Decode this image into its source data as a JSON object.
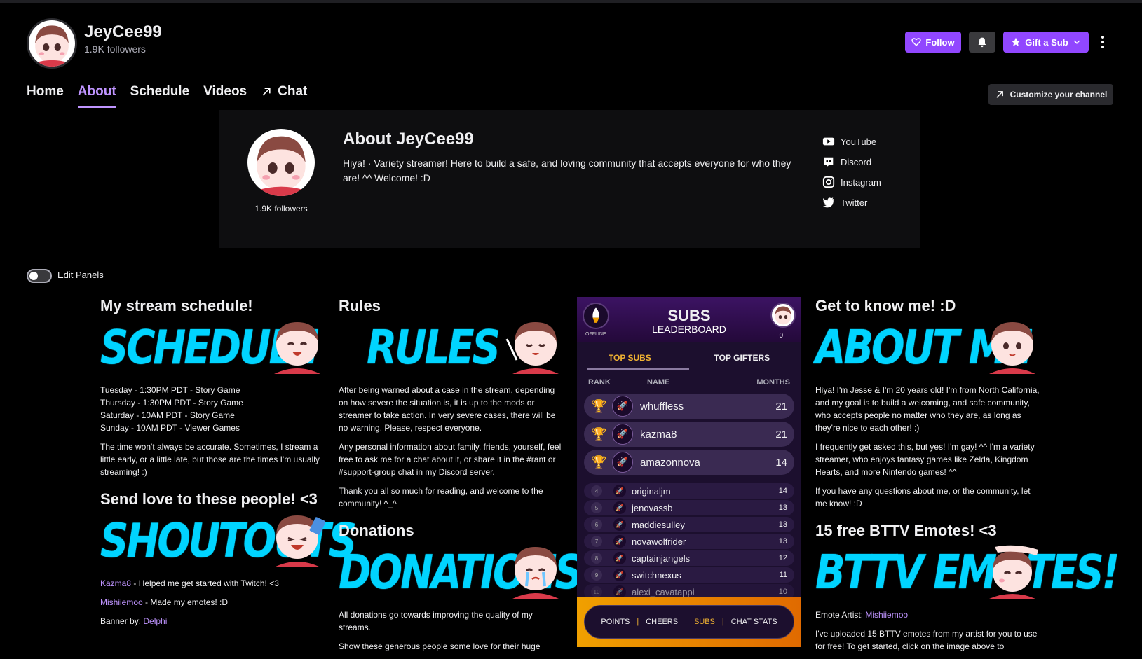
{
  "channel": {
    "name": "JeyCee99",
    "followers": "1.9K followers"
  },
  "actions": {
    "follow": "Follow",
    "gift": "Gift a Sub"
  },
  "nav": {
    "home": "Home",
    "about": "About",
    "schedule": "Schedule",
    "videos": "Videos",
    "chat": "Chat",
    "customize": "Customize your channel"
  },
  "about": {
    "title": "About JeyCee99",
    "followers": "1.9K followers",
    "description": "Hiya! · Variety streamer! Here to build a safe, and loving community that accepts everyone for who they are! ^^ Welcome! :D",
    "socials": [
      "YouTube",
      "Discord",
      "Instagram",
      "Twitter"
    ]
  },
  "edit_panels": "Edit Panels",
  "panels": {
    "schedule": {
      "title": "My stream schedule!",
      "image_text": "SCHEDULE",
      "lines": [
        "Tuesday - 1:30PM PDT - Story Game",
        "Thursday - 1:30PM PDT - Story Game",
        "Saturday - 10AM PDT - Story Game",
        "Sunday - 10AM PDT - Viewer Games"
      ],
      "note": "The time won't always be accurate. Sometimes, I stream a little early, or a little late, but those are the times I'm usually streaming! :)"
    },
    "shoutouts": {
      "title": "Send love to these people! <3",
      "image_text": "SHOUTOUTS",
      "items": [
        {
          "link": "Kazma8",
          "text": " - Helped me get started with Twitch! <3"
        },
        {
          "link": "Mishiiemoo",
          "text": " - Made my emotes! :D"
        },
        {
          "label": "Banner by: ",
          "link": "Delphi"
        }
      ]
    },
    "rules": {
      "title": "Rules",
      "image_text": "RULES",
      "paragraphs": [
        "After being warned about a case in the stream, depending on how severe the situation is, it is up to the mods or streamer to take action. In very severe cases, there will be no warning. Please, respect everyone.",
        "Any personal information about family, friends, yourself, feel free to ask me for a chat about it, or share it in the #rant or #support-group chat in my Discord server.",
        "Thank you all so much for reading, and welcome to the community! ^_^"
      ]
    },
    "donations": {
      "title": "Donations",
      "image_text": "DONATIONS",
      "paragraphs": [
        "All donations go towards improving the quality of my streams.",
        "Show these generous people some love for their huge"
      ]
    },
    "aboutme": {
      "title": "Get to know me! :D",
      "image_text": "ABOUT ME",
      "paragraphs": [
        "Hiya! I'm Jesse & I'm 20 years old! I'm from North California, and my goal is to build a welcoming, and safe community, who accepts people no matter who they are, as long as they're nice to each other! :)",
        "I frequently get asked this, but yes! I'm gay! ^^ I'm a variety streamer, who enjoys fantasy games like Zelda, Kingdom Hearts, and more Nintendo games! ^^",
        "If you have any questions about me, or the community, let me know! :D"
      ]
    },
    "bttv": {
      "title": "15 free BTTV Emotes! <3",
      "image_text": "BTTV EMOTES!",
      "artist_label": "Emote Artist: ",
      "artist": "Mishiiemoo",
      "text": "I've uploaded 15 BTTV emotes from my artist for you to use for free! To get started, click on the image above to"
    }
  },
  "leaderboard": {
    "title": "SUBS",
    "subtitle": "LEADERBOARD",
    "offline": "OFFLINE",
    "count": "0",
    "tabs": [
      "TOP SUBS",
      "TOP GIFTERS"
    ],
    "headers": [
      "RANK",
      "NAME",
      "MONTHS"
    ],
    "top": [
      {
        "name": "whuffless",
        "months": "21"
      },
      {
        "name": "kazma8",
        "months": "21"
      },
      {
        "name": "amazonnova",
        "months": "14"
      }
    ],
    "rest": [
      {
        "rank": "4",
        "name": "originaljm",
        "months": "14"
      },
      {
        "rank": "5",
        "name": "jenovassb",
        "months": "13"
      },
      {
        "rank": "6",
        "name": "maddiesulley",
        "months": "13"
      },
      {
        "rank": "7",
        "name": "novawolfrider",
        "months": "13"
      },
      {
        "rank": "8",
        "name": "captainjangels",
        "months": "12"
      },
      {
        "rank": "9",
        "name": "switchnexus",
        "months": "11"
      },
      {
        "rank": "10",
        "name": "alexi_cavatappi",
        "months": "10"
      }
    ],
    "nav": [
      "POINTS",
      "CHEERS",
      "SUBS",
      "CHAT STATS"
    ],
    "colors": {
      "accent": "#f0b232",
      "bg": "#1c0f2e"
    }
  },
  "colors": {
    "brand": "#9147ff",
    "link": "#bf94ff",
    "panel_art": "#00d4ff"
  }
}
